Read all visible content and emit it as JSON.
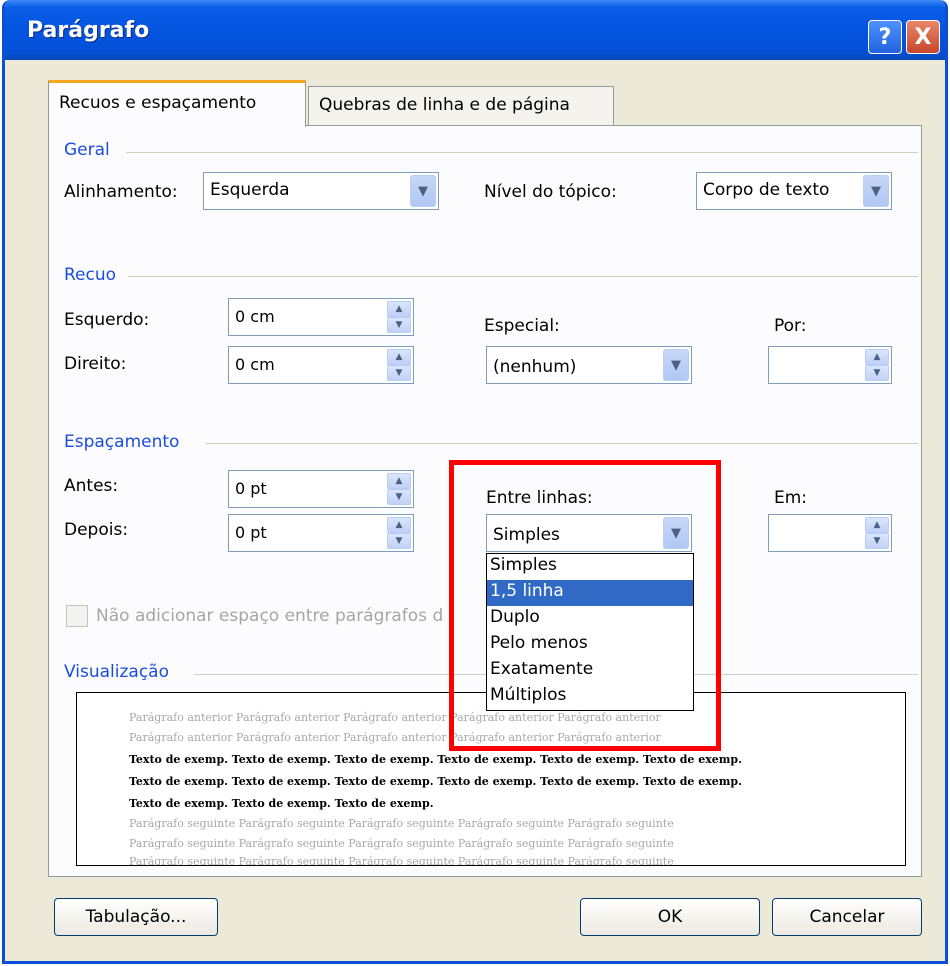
{
  "window": {
    "title": "Parágrafo",
    "help_label": "?",
    "close_label": "X"
  },
  "tabs": [
    {
      "label": "Recuos e espaçamento"
    },
    {
      "label": "Quebras de linha e de página"
    }
  ],
  "geral": {
    "title": "Geral",
    "alinhamento": {
      "label": "Alinhamento:",
      "value": "Esquerda"
    },
    "nivel": {
      "label": "Nível do tópico:",
      "value": "Corpo de texto"
    }
  },
  "recuo": {
    "title": "Recuo",
    "esquerdo": {
      "label": "Esquerdo:",
      "value": "0 cm"
    },
    "direito": {
      "label": "Direito:",
      "value": "0 cm"
    },
    "especial": {
      "label": "Especial:",
      "value": "(nenhum)"
    },
    "por": {
      "label": "Por:",
      "value": ""
    }
  },
  "espacamento": {
    "title": "Espaçamento",
    "antes": {
      "label": "Antes:",
      "value": "0 pt"
    },
    "depois": {
      "label": "Depois:",
      "value": "0 pt"
    },
    "entre_linhas": {
      "label": "Entre linhas:",
      "value": "Simples",
      "options": [
        "Simples",
        "1,5 linha",
        "Duplo",
        "Pelo menos",
        "Exatamente",
        "Múltiplos"
      ],
      "highlighted": "1,5 linha"
    },
    "em": {
      "label": "Em:",
      "value": ""
    },
    "checkbox_label": "Não adicionar espaço entre parágrafos d"
  },
  "visualizacao": {
    "title": "Visualização",
    "prev_line": "Parágrafo anterior Parágrafo anterior Parágrafo anterior Parágrafo anterior Parágrafo anterior",
    "sample_line_long": "Texto de exemp. Texto de exemp. Texto de exemp. Texto de exemp. Texto de exemp. Texto de exemp.",
    "sample_line_short": "Texto de exemp. Texto de exemp. Texto de exemp.",
    "next_line": "Parágrafo seguinte Parágrafo seguinte Parágrafo seguinte Parágrafo seguinte Parágrafo seguinte"
  },
  "buttons": {
    "tabulacao": "Tabulação...",
    "ok": "OK",
    "cancelar": "Cancelar"
  }
}
